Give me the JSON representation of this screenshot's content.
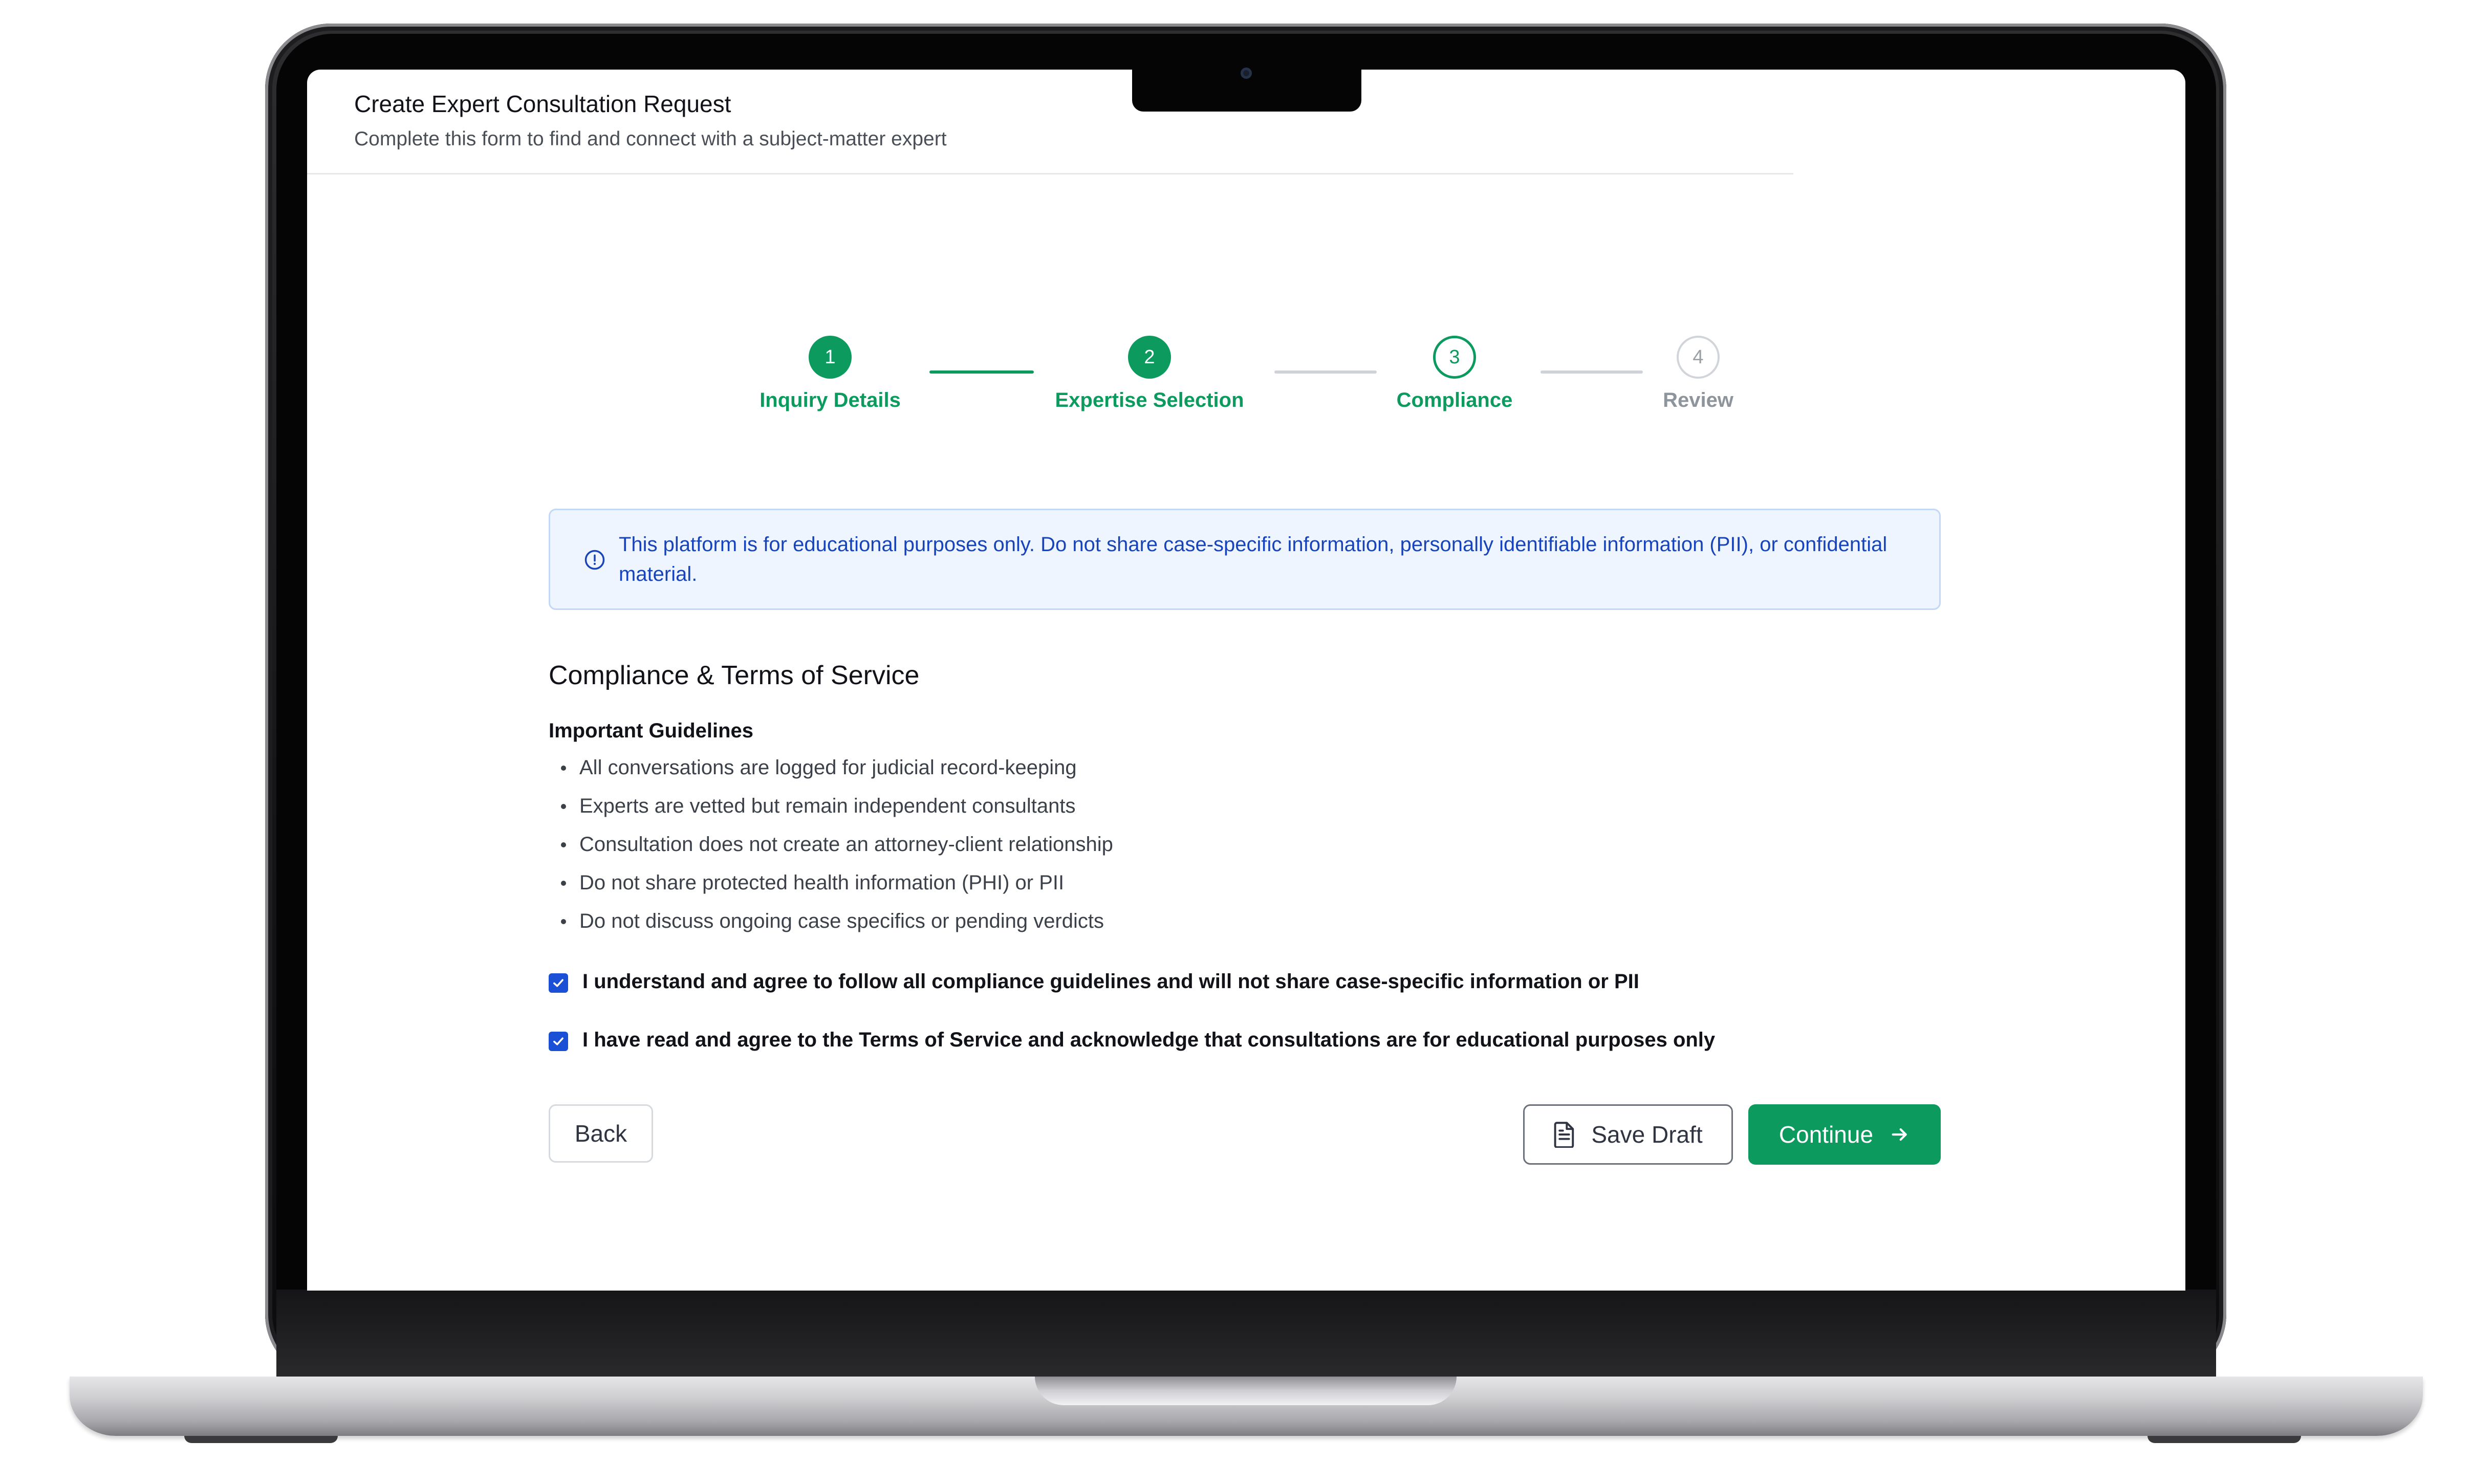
{
  "header": {
    "title": "Create Expert Consultation Request",
    "subtitle": "Complete this form to find and connect with a subject-matter expert"
  },
  "stepper": {
    "current_step": 3,
    "steps": [
      {
        "number": "1",
        "label": "Inquiry Details",
        "status": "done"
      },
      {
        "number": "2",
        "label": "Expertise Selection",
        "status": "done"
      },
      {
        "number": "3",
        "label": "Compliance",
        "status": "current"
      },
      {
        "number": "4",
        "label": "Review",
        "status": "upcoming"
      }
    ]
  },
  "notice": {
    "icon": "info-circle-icon",
    "text": "This platform is for educational purposes only. Do not share case-specific information, personally identifiable information (PII), or confidential material."
  },
  "compliance": {
    "title": "Compliance & Terms of Service",
    "guidelines_heading": "Important Guidelines",
    "guidelines": [
      "All conversations are logged for judicial record-keeping",
      "Experts are vetted but remain independent consultants",
      "Consultation does not create an attorney-client relationship",
      "Do not share protected health information (PHI) or PII",
      "Do not discuss ongoing case specifics or pending verdicts"
    ],
    "agreements": [
      {
        "label": "I understand and agree to follow all compliance guidelines and will not share case-specific information or PII",
        "checked": true
      },
      {
        "label": "I have read and agree to the Terms of Service and acknowledge that consultations are for educational purposes only",
        "checked": true
      }
    ]
  },
  "actions": {
    "back_label": "Back",
    "save_draft_label": "Save Draft",
    "save_draft_icon": "document-icon",
    "continue_label": "Continue",
    "continue_icon": "arrow-right-icon"
  },
  "colors": {
    "accent_green": "#0c9a5e",
    "notice_text": "#1844b8",
    "notice_bg": "#eef5fe",
    "checkbox_blue": "#1a4fd6"
  }
}
